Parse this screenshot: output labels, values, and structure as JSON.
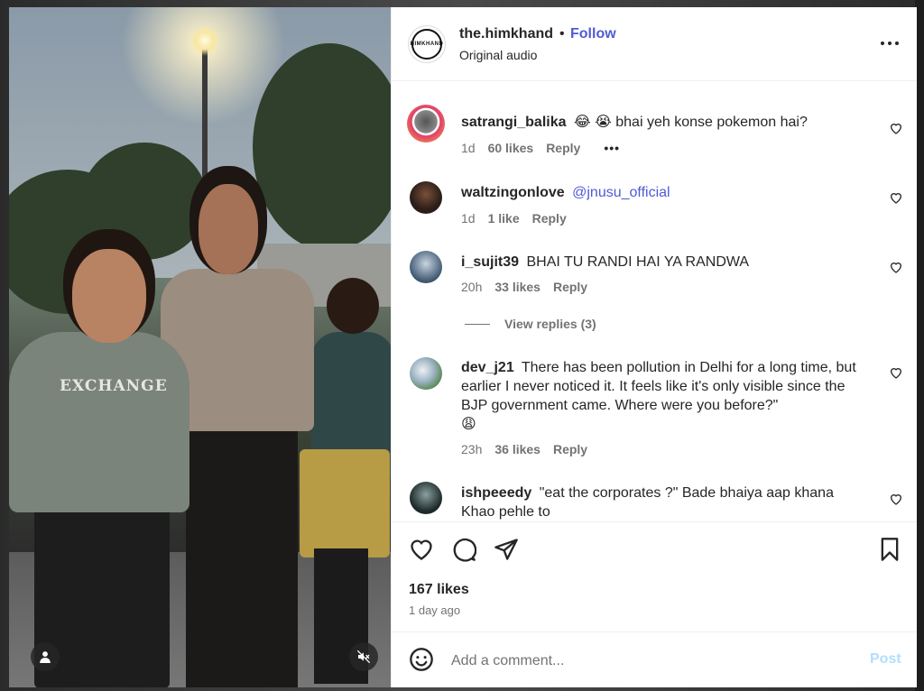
{
  "post": {
    "username": "the.himkhand",
    "separator": "•",
    "follow_label": "Follow",
    "audio": "Original audio",
    "logo_text": "HIMKHAND"
  },
  "comments": [
    {
      "username": "satrangi_balika",
      "emoji": "😂 😭",
      "text": "bhai yeh konse pokemon hai?",
      "age": "1d",
      "likes": "60 likes",
      "reply": "Reply",
      "more": "•••"
    },
    {
      "username": "waltzingonlove",
      "mention": "@jnusu_official",
      "age": "1d",
      "likes": "1 like",
      "reply": "Reply"
    },
    {
      "username": "i_sujit39",
      "text": "BHAI TU RANDI HAI YA RANDWA",
      "age": "20h",
      "likes": "33 likes",
      "reply": "Reply",
      "view_replies": "View replies (3)"
    },
    {
      "username": "dev_j21",
      "text": "There has been pollution in Delhi for a long time, but earlier I never noticed it. It feels like it's only visible since the BJP government came. Where were you before?\"",
      "emoji": "😩",
      "age": "23h",
      "likes": "36 likes",
      "reply": "Reply"
    },
    {
      "username": "ishpeeedy",
      "text": "\"eat the corporates ?\" Bade bhaiya aap khana Khao pehle to"
    }
  ],
  "actions": {
    "likes": "167 likes",
    "time": "1 day ago"
  },
  "add_comment": {
    "placeholder": "Add a comment...",
    "post_label": "Post"
  },
  "video": {
    "hoodie_text": "EXCHANGE"
  },
  "colors": {
    "link": "#4f5bd5",
    "muted": "#737373",
    "post_disabled": "#b2dffc"
  }
}
